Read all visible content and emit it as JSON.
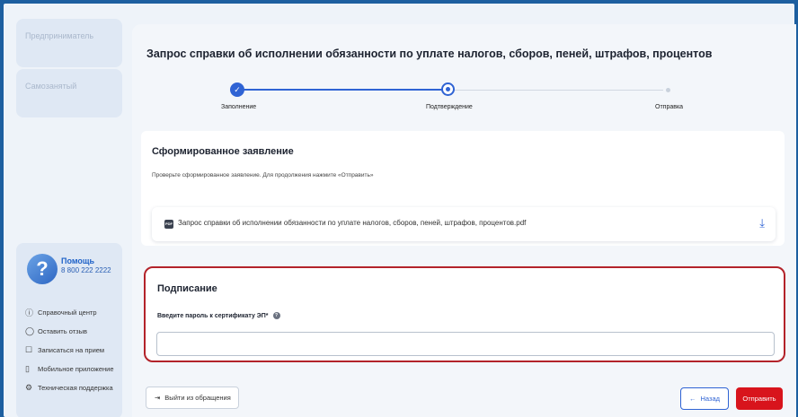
{
  "sidebar": {
    "items": [
      {
        "label": "Предприниматель"
      },
      {
        "label": "Самозанятый"
      }
    ],
    "help": {
      "title": "Помощь",
      "phone": "8 800 222 2222",
      "links": [
        {
          "icon": "info-icon",
          "glyph": "ⓘ",
          "label": "Справочный центр"
        },
        {
          "icon": "chat-icon",
          "glyph": "◯",
          "label": "Оставить отзыв"
        },
        {
          "icon": "calendar-edit-icon",
          "glyph": "☐",
          "label": "Записаться на прием"
        },
        {
          "icon": "mobile-icon",
          "glyph": "▯",
          "label": "Мобильное приложение"
        },
        {
          "icon": "gear-icon",
          "glyph": "⚙",
          "label": "Техническая поддержка"
        }
      ]
    }
  },
  "main": {
    "title": "Запрос справки об исполнении обязанности по уплате налогов, сборов, пеней, штрафов, процентов",
    "stepper": {
      "steps": [
        {
          "label": "Заполнение",
          "state": "done"
        },
        {
          "label": "Подтверждение",
          "state": "current"
        },
        {
          "label": "Отправка",
          "state": "pending"
        }
      ]
    },
    "formed": {
      "title": "Сформированное заявление",
      "hint": "Проверьте сформированное заявление. Для продолжения нажмите «Отправить»",
      "file_badge": "PDF",
      "file_name": "Запрос справки об исполнении обязанности по уплате налогов, сборов, пеней, штрафов, процентов.pdf"
    },
    "signing": {
      "title": "Подписание",
      "password_label": "Введите пароль к сертификату ЭП*",
      "password_value": ""
    },
    "actions": {
      "exit_label": "Выйти из обращения",
      "back_label": "Назад",
      "send_label": "Отправить"
    }
  },
  "colors": {
    "accent": "#2f63d4",
    "danger": "#d8141c",
    "highlight_border": "#b3232a"
  }
}
